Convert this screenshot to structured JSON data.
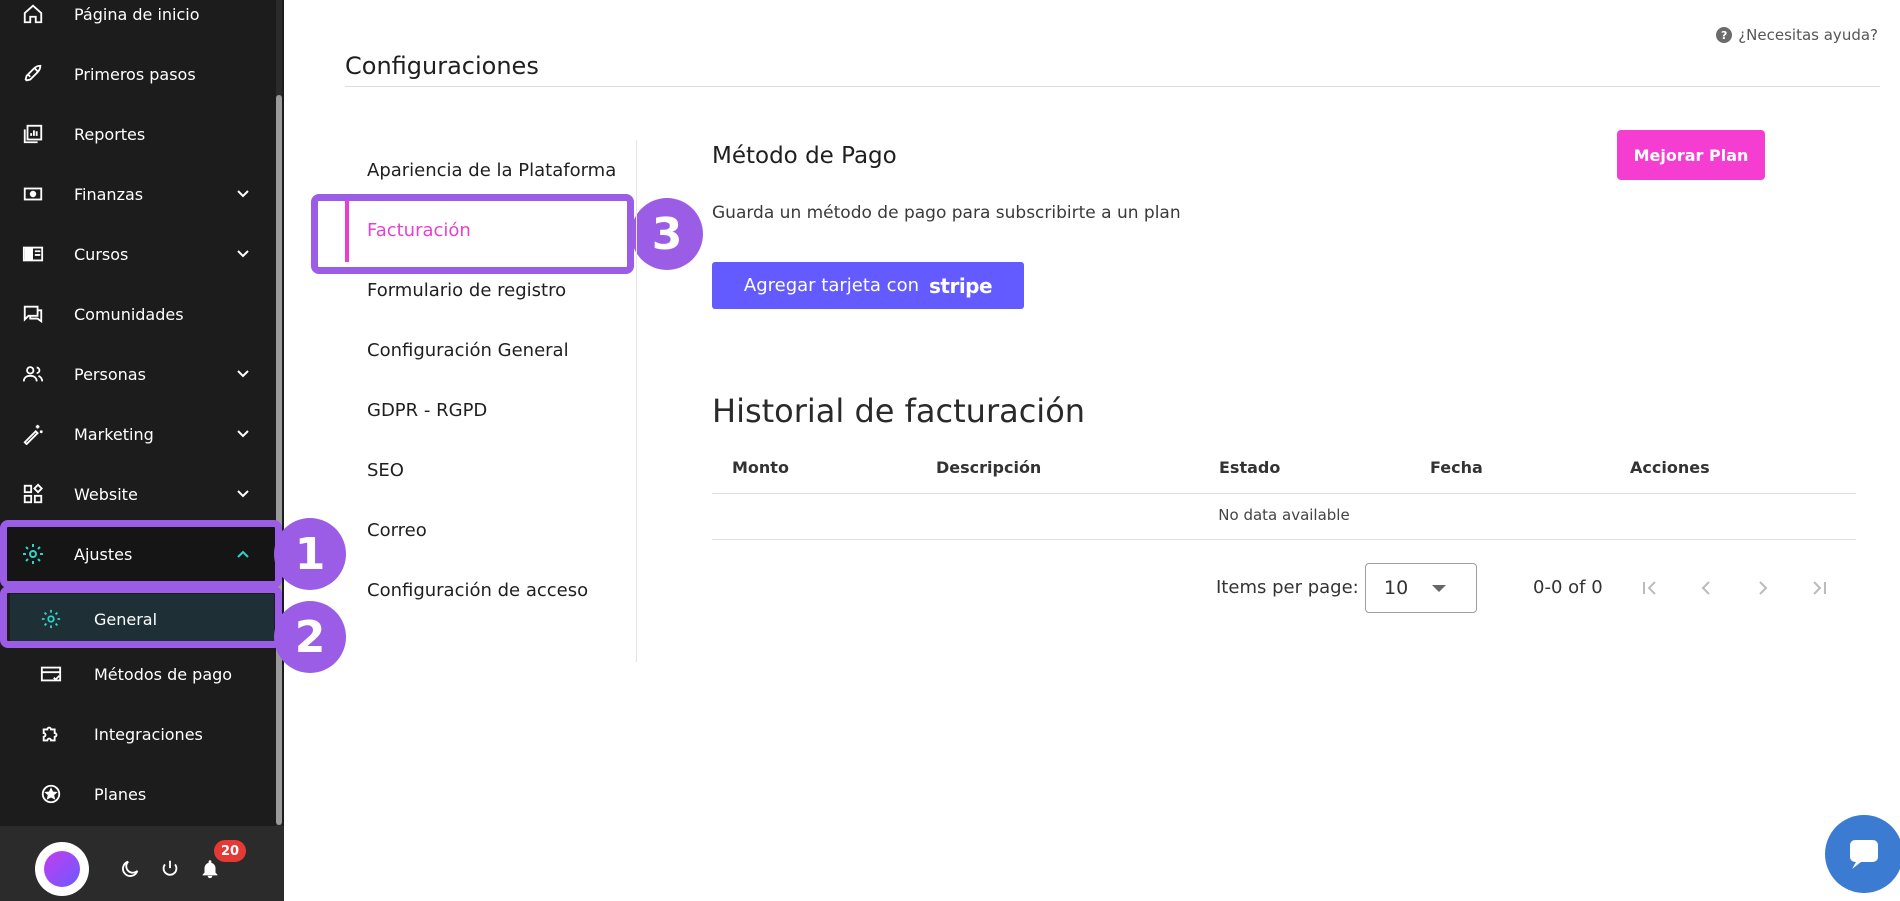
{
  "sidebar": {
    "items": [
      {
        "label": "Página de inicio",
        "icon": "home-icon"
      },
      {
        "label": "Primeros pasos",
        "icon": "rocket-icon"
      },
      {
        "label": "Reportes",
        "icon": "reports-icon"
      },
      {
        "label": "Finanzas",
        "icon": "money-icon"
      },
      {
        "label": "Cursos",
        "icon": "course-icon"
      },
      {
        "label": "Comunidades",
        "icon": "chat-icon"
      },
      {
        "label": "Personas",
        "icon": "people-icon"
      },
      {
        "label": "Marketing",
        "icon": "magic-wand-icon"
      },
      {
        "label": "Website",
        "icon": "widgets-icon"
      },
      {
        "label": "Ajustes",
        "icon": "gear-icon"
      }
    ],
    "subitems": [
      {
        "label": "General",
        "icon": "gear-icon"
      },
      {
        "label": "Métodos de pago",
        "icon": "card-icon"
      },
      {
        "label": "Integraciones",
        "icon": "puzzle-icon"
      },
      {
        "label": "Planes",
        "icon": "star-icon"
      }
    ],
    "notifications_count": "20"
  },
  "annotations": [
    "1",
    "2",
    "3"
  ],
  "help": {
    "label": "¿Necesitas ayuda?"
  },
  "page": {
    "title": "Configuraciones"
  },
  "settings_nav": [
    "Apariencia de la Plataforma",
    "Facturación",
    "Formulario de registro",
    "Configuración General",
    "GDPR - RGPD",
    "SEO",
    "Correo",
    "Configuración de acceso"
  ],
  "payment": {
    "title": "Método de Pago",
    "upgrade_label": "Mejorar Plan",
    "description": "Guarda un método de pago para subscribirte a un plan",
    "stripe_label": "Agregar tarjeta con",
    "stripe_brand": "stripe"
  },
  "history": {
    "title": "Historial de facturación",
    "columns": [
      "Monto",
      "Descripción",
      "Estado",
      "Fecha",
      "Acciones"
    ],
    "empty": "No data available",
    "items_per_page_label": "Items per page:",
    "items_per_page": "10",
    "range": "0-0 of 0"
  },
  "colors": {
    "accent": "#e83fd0",
    "highlight": "#9b5de5",
    "stripe": "#635bff",
    "sidebar": "#1c1c1c",
    "teal": "#2ed3c6"
  }
}
